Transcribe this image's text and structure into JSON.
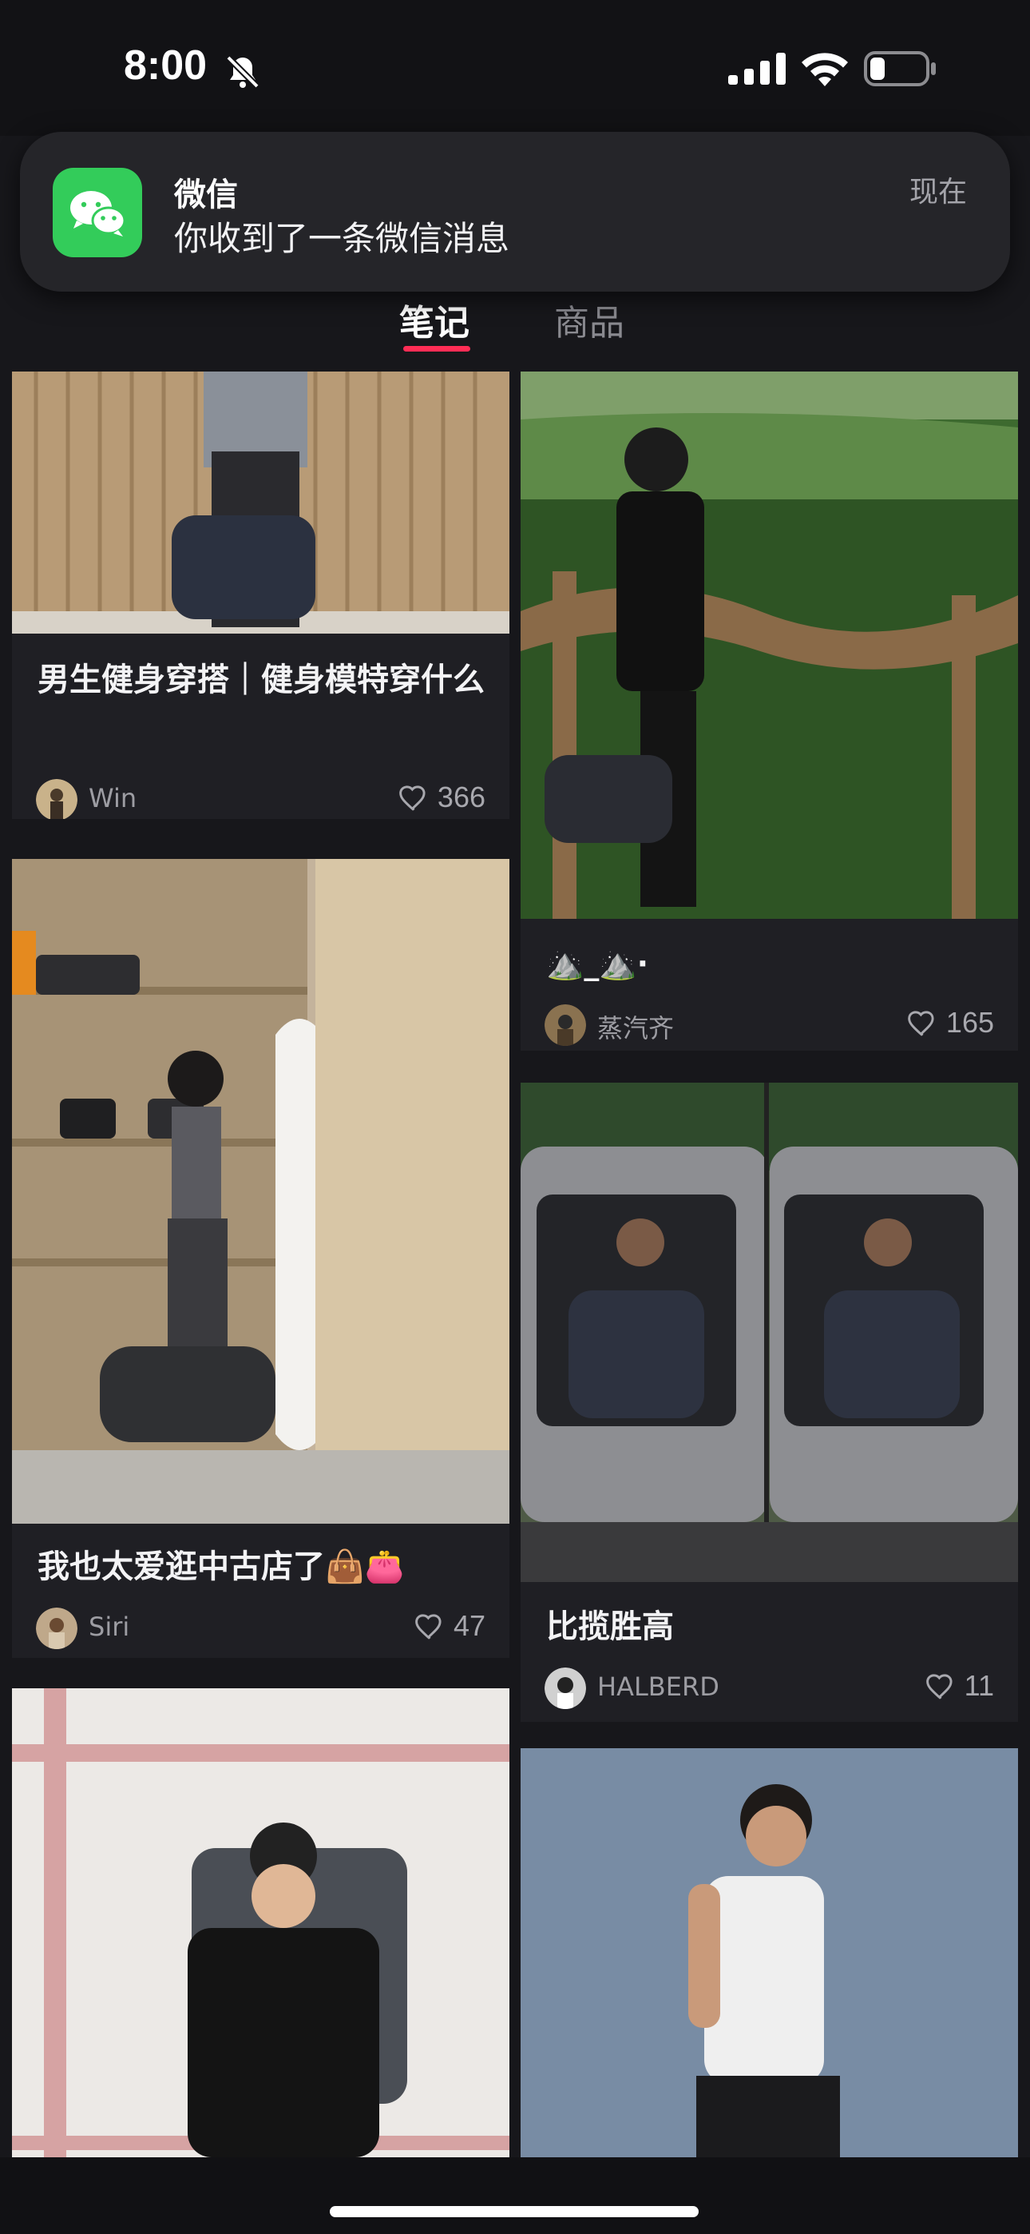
{
  "status_bar": {
    "time": "8:00",
    "icons": [
      "bell-slash-icon",
      "cellular-signal-icon",
      "wifi-icon",
      "battery-icon"
    ]
  },
  "notification": {
    "app": "微信",
    "message": "你收到了一条微信消息",
    "time": "现在",
    "icon": "wechat-icon",
    "accent": "#33cc5a"
  },
  "tabs": [
    {
      "label": "笔记",
      "active": true
    },
    {
      "label": "商品",
      "active": false
    }
  ],
  "accent_color": "#ff2d55",
  "feed": {
    "left": [
      {
        "title": "男生健身穿搭｜健身模特穿什么",
        "author": "Win",
        "likes": "366"
      },
      {
        "title": "我也太爱逛中古店了👜👛",
        "author": "Siri",
        "likes": "47"
      },
      {
        "title": "",
        "author": "",
        "likes": ""
      }
    ],
    "right": [
      {
        "title": "⛰️_⛰️·",
        "author": "蒸汽齐",
        "likes": "165"
      },
      {
        "title": "比揽胜高",
        "author": "HALBERD",
        "likes": "11"
      },
      {
        "title": "",
        "author": "",
        "likes": ""
      }
    ]
  }
}
